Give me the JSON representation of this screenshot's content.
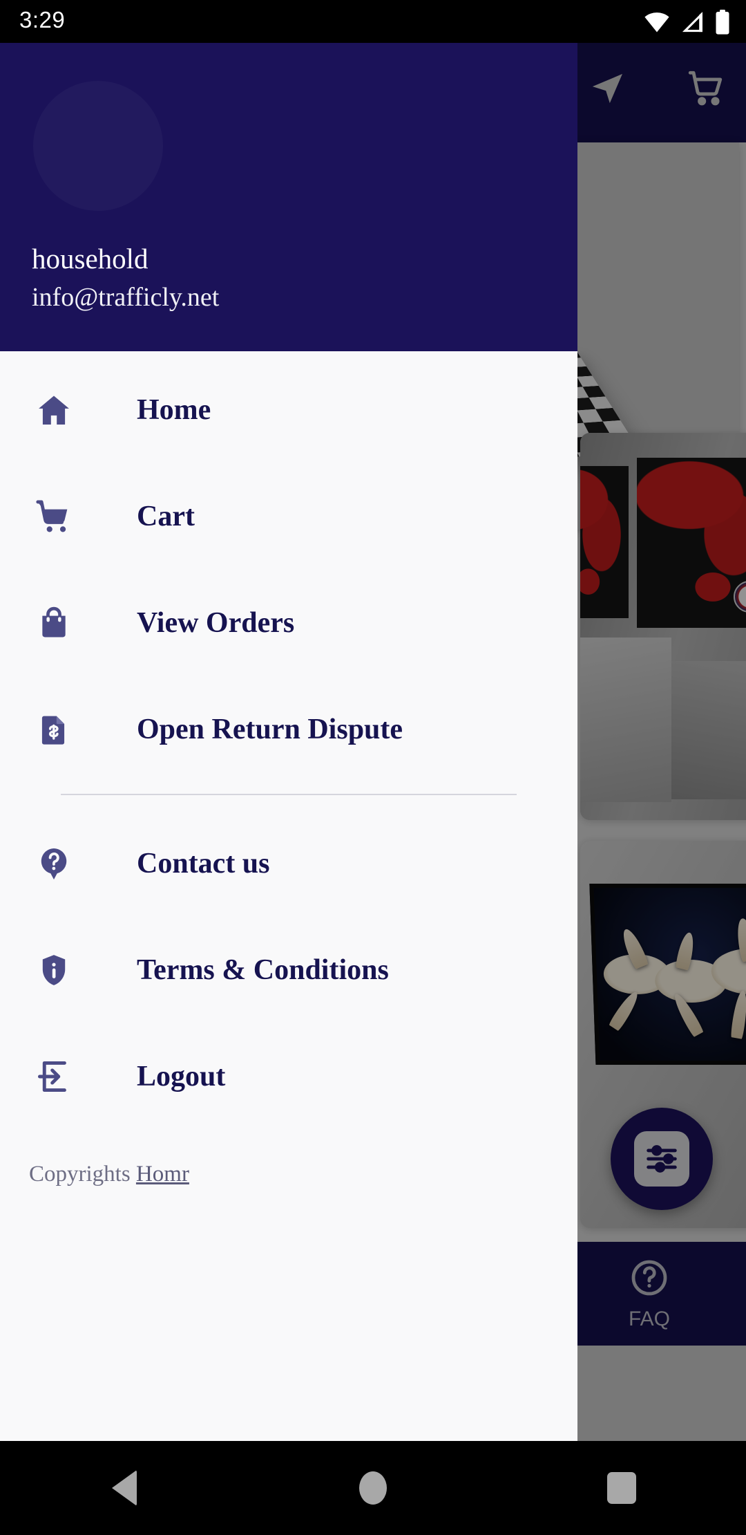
{
  "status_bar": {
    "time": "3:29",
    "icons": [
      "wifi-icon",
      "cellular-signal-icon",
      "battery-icon"
    ]
  },
  "background_app": {
    "app_bar": {
      "icons": [
        "navigation-send-icon",
        "cart-icon"
      ]
    },
    "product_cards": [
      {
        "name": "chess-set-product-image"
      },
      {
        "name": "world-map-wall-art-product-image"
      },
      {
        "name": "ballet-dancers-wall-art-product-image"
      }
    ],
    "fab": {
      "icon": "filter-sliders-icon"
    },
    "bottom_nav": [
      {
        "label": "FAQ",
        "icon": "question-circle-icon"
      }
    ]
  },
  "drawer": {
    "header": {
      "avatar": "user-avatar-placeholder",
      "name": "household",
      "email": "info@trafficly.net"
    },
    "menu": [
      {
        "label": "Home",
        "icon": "home-icon"
      },
      {
        "label": "Cart",
        "icon": "cart-icon"
      },
      {
        "label": "View Orders",
        "icon": "shopping-bag-icon"
      },
      {
        "label": "Open Return Dispute",
        "icon": "receipt-dollar-icon"
      }
    ],
    "secondary_menu": [
      {
        "label": "Contact us",
        "icon": "help-marker-icon"
      },
      {
        "label": "Terms & Conditions",
        "icon": "shield-info-icon"
      },
      {
        "label": "Logout",
        "icon": "exit-arrow-icon"
      }
    ],
    "footer": {
      "prefix": "Copyrights",
      "link": "Homr"
    }
  },
  "android_nav": {
    "back": "back-button",
    "home": "home-button",
    "recents": "recents-button"
  },
  "colors": {
    "drawer_header": "#1b1259",
    "drawer_bg": "#f9f9fa",
    "menu_label": "#161350",
    "menu_icon": "#4b4b86",
    "app_bar": "#140f4b",
    "fab": "#1b1259"
  }
}
